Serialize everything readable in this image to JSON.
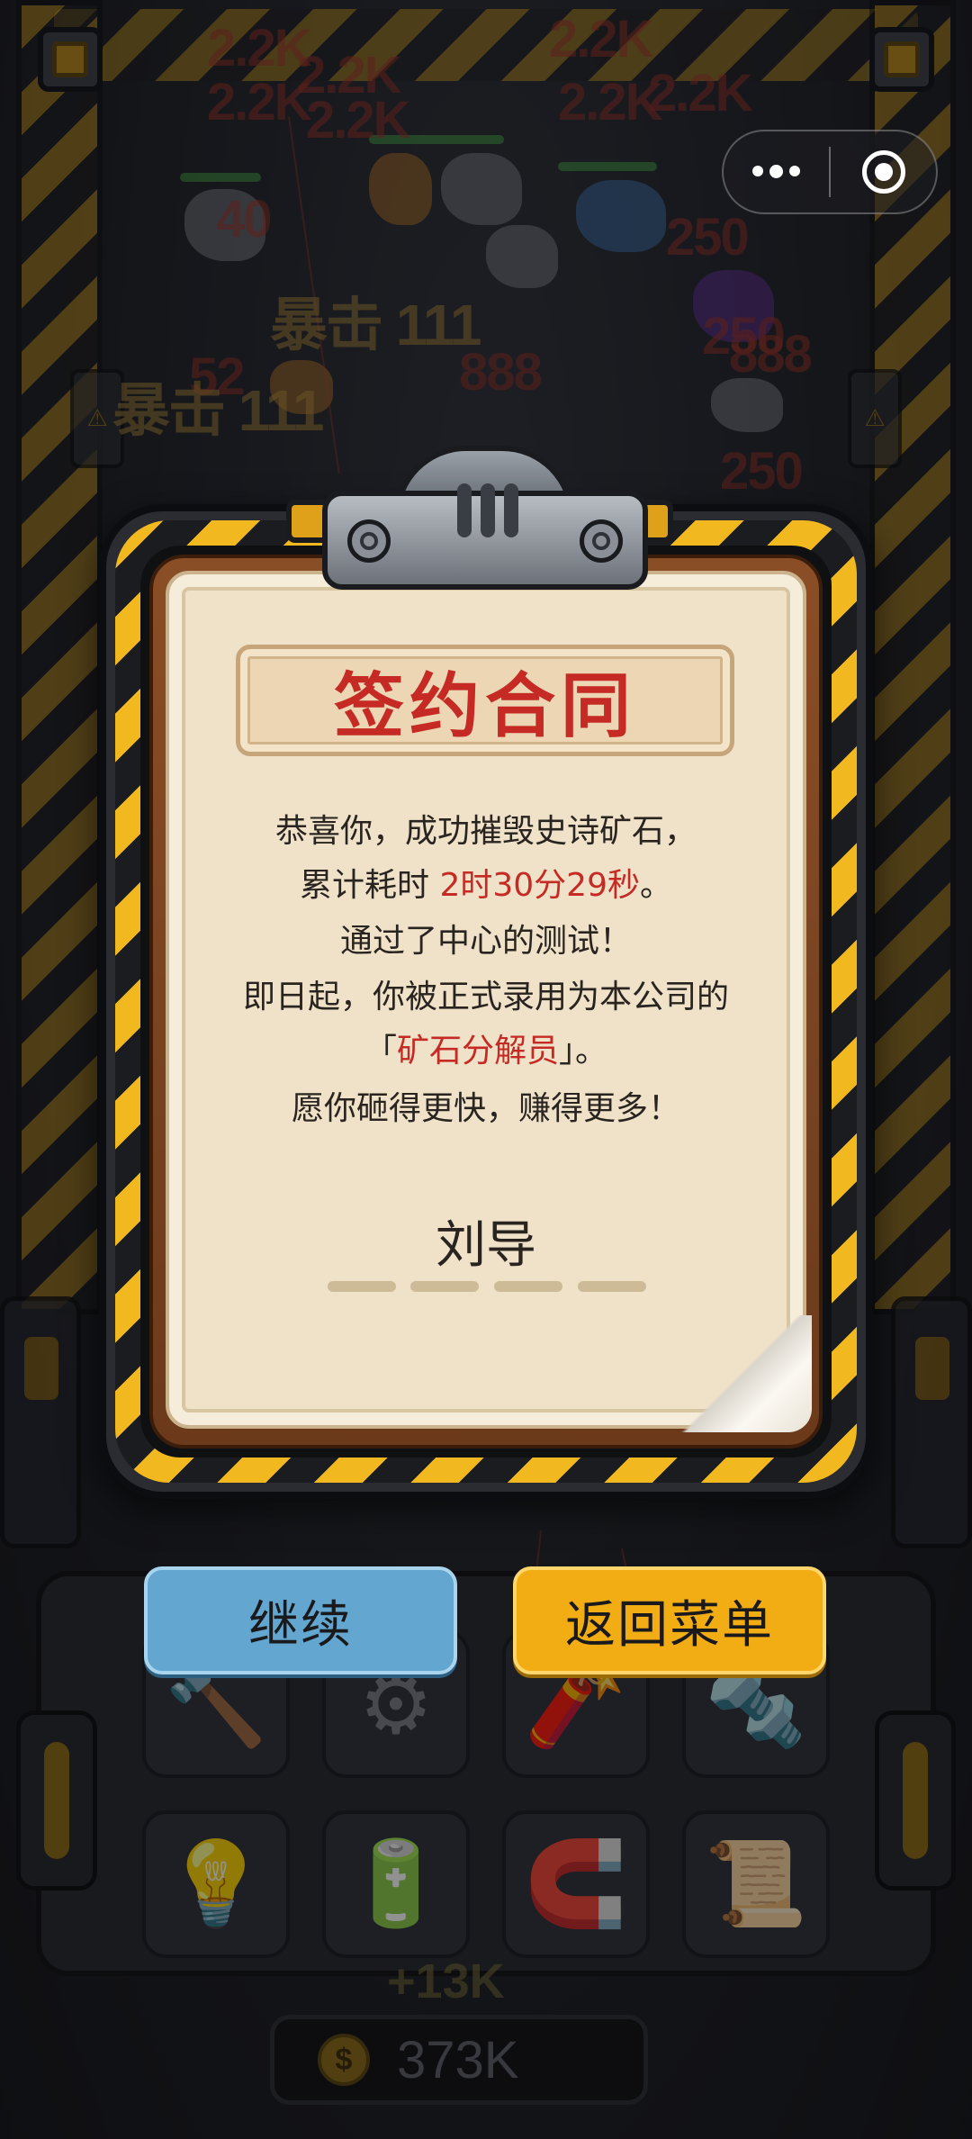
{
  "capsule": {
    "more_icon": "more-dots-icon",
    "close_icon": "target-circle-icon"
  },
  "scene": {
    "damage_numbers": [
      "2.2K",
      "2.2K",
      "2.2K",
      "2.2K",
      "2.2K",
      "2.2K",
      "2.2K",
      "40",
      "250",
      "250",
      "250",
      "52",
      "888",
      "888"
    ],
    "crit_labels": [
      "暴击 111",
      "暴击 111"
    ],
    "float_gain": "+13K",
    "tools": [
      "hammer",
      "gear",
      "dynamite",
      "drill",
      "lightbulb",
      "battery",
      "magnet",
      "blueprint"
    ],
    "coin_symbol": "$",
    "coin_total": "373K"
  },
  "dialog": {
    "title": "签约合同",
    "lines": {
      "l1": "恭喜你，成功摧毁史诗矿石，",
      "l2_prefix": "累计耗时 ",
      "l2_time": "2时30分29秒",
      "l2_suffix": "。",
      "l3": "通过了中心的测试！",
      "l4": "即日起，你被正式录用为本公司的",
      "l5_open": "「",
      "l5_role": "矿石分解员",
      "l5_close": "」。",
      "l6": "愿你砸得更快，赚得更多！"
    },
    "signature": "刘导"
  },
  "buttons": {
    "continue": "继续",
    "menu": "返回菜单"
  },
  "colors": {
    "accent_red": "#c52b24",
    "continue_blue": "#63a6cf",
    "menu_orange": "#f2ad14",
    "hazard_yellow": "#f1b91f"
  }
}
